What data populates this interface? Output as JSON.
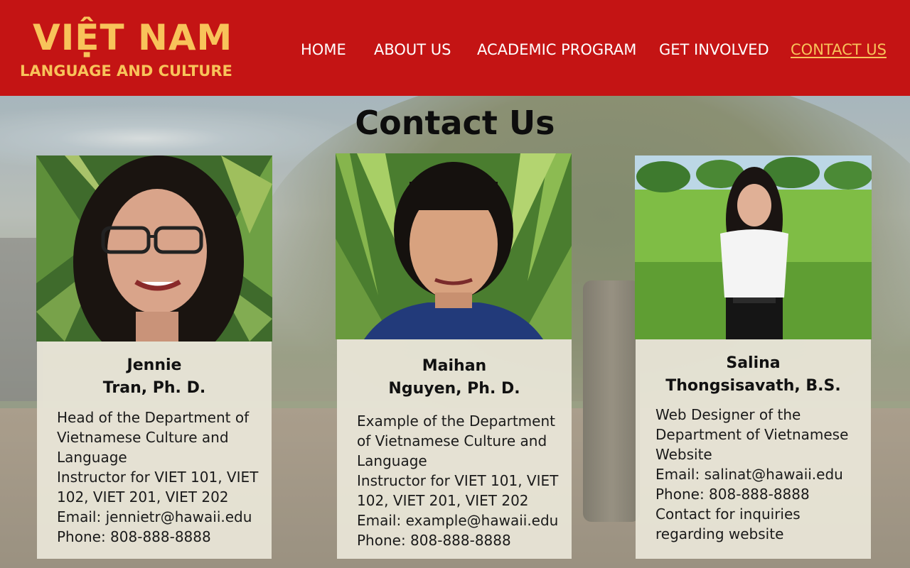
{
  "header": {
    "logo_title": "VIỆT NAM",
    "logo_subtitle": "LANGUAGE AND CULTURE",
    "nav": [
      {
        "label": "HOME",
        "active": false
      },
      {
        "label": "ABOUT US",
        "active": false
      },
      {
        "label": "ACADEMIC PROGRAM",
        "active": false
      },
      {
        "label": "GET INVOLVED",
        "active": false
      },
      {
        "label": "CONTACT US",
        "active": true
      }
    ]
  },
  "page_title": "Contact Us",
  "contacts": [
    {
      "name_line1": "Jennie",
      "name_line2": "Tran, Ph. D.",
      "lines": [
        "Head of the Department of",
        "Vietnamese Culture and",
        "Language",
        "Instructor for VIET 101, VIET",
        "102, VIET 201, VIET 202",
        "Email: jennietr@hawaii.edu",
        "Phone: 808-888-8888"
      ]
    },
    {
      "name_line1": "Maihan",
      "name_line2": "Nguyen, Ph. D.",
      "lines": [
        "Example of the Department",
        "of Vietnamese Culture and",
        "Language",
        "Instructor for VIET 101, VIET",
        "102, VIET 201, VIET 202",
        "Email: example@hawaii.edu",
        "Phone: 808-888-8888"
      ]
    },
    {
      "name_line1": "Salina",
      "name_line2": "Thongsisavath, B.S.",
      "lines": [
        "Web Designer of the",
        "Department of Vietnamese",
        "Website",
        "Email: salinat@hawaii.edu",
        "Phone: 808-888-8888",
        "Contact for inquiries",
        "regarding website"
      ]
    }
  ],
  "colors": {
    "header_bg": "#c41414",
    "accent_gold": "#f8c35a",
    "card_bg": "#e9e6d8"
  }
}
